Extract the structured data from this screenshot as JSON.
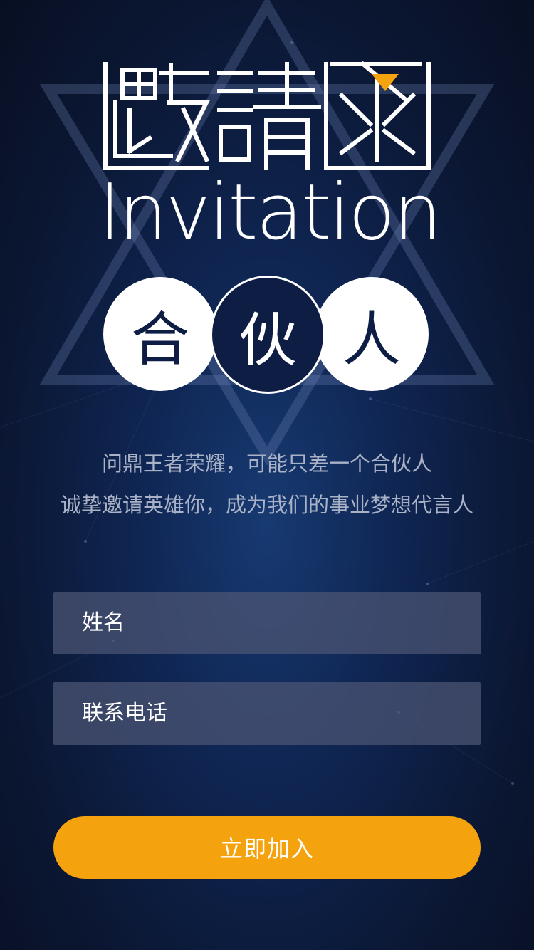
{
  "colors": {
    "background": "#0b1733",
    "accent": "#f4a20d",
    "field_bg": "#4e5674",
    "circle_dark": "#0e1d44",
    "text_muted": "#a9b2c6"
  },
  "header": {
    "title_cn": "邀請函",
    "title_en": "Invitation"
  },
  "partner": {
    "chars": [
      "合",
      "伙",
      "人"
    ]
  },
  "tagline": {
    "line1": "问鼎王者荣耀，可能只差一个合伙人",
    "line2": "诚挚邀请英雄你，成为我们的事业梦想代言人"
  },
  "form": {
    "name_placeholder": "姓名",
    "phone_placeholder": "联系电话",
    "submit_label": "立即加入"
  }
}
